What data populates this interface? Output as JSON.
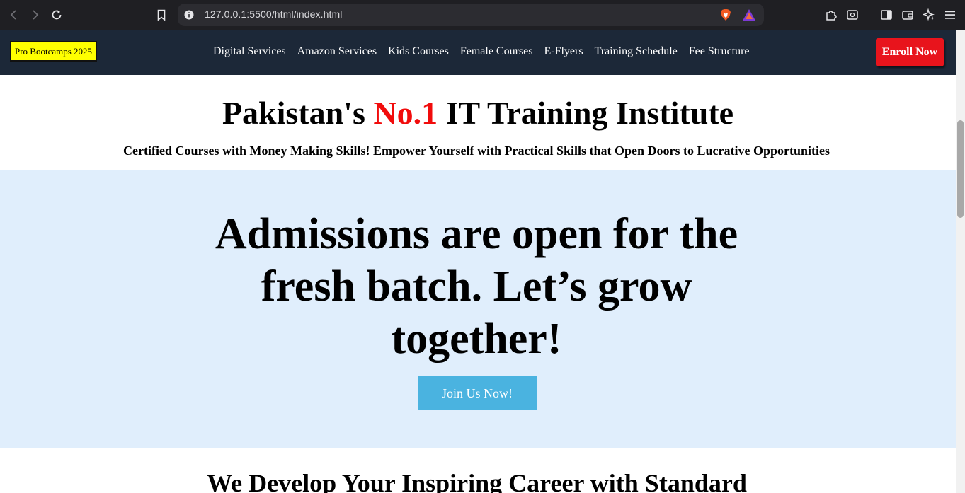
{
  "browser": {
    "url": "127.0.0.1:5500/html/index.html",
    "icons": [
      "back-icon",
      "forward-icon",
      "reload-icon",
      "bookmark-icon",
      "info-icon",
      "brave-shield-icon",
      "brave-rewards-icon",
      "extensions-icon",
      "screenshot-icon",
      "sidebar-icon",
      "wallet-icon",
      "leo-ai-icon",
      "menu-icon"
    ]
  },
  "navbar": {
    "brand": "Pro Bootcamps 2025",
    "links": [
      "Digital Services",
      "Amazon Services",
      "Kids Courses",
      "Female Courses",
      "E-Flyers",
      "Training Schedule",
      "Fee Structure"
    ],
    "enroll": "Enroll Now"
  },
  "hero": {
    "title_before": "Pakistan's ",
    "title_accent": "No.1",
    "title_after": " IT Training Institute",
    "subtitle": "Certified Courses with Money Making Skills! Empower Yourself with Practical Skills that Open Doors to Lucrative Opportunities"
  },
  "admissions": {
    "heading": "Admissions are open for the fresh batch. Let’s grow together!",
    "button": "Join Us Now!"
  },
  "career": {
    "heading": "We Develop Your Inspiring Career with Standard"
  },
  "colors": {
    "navbar_bg": "#1c2838",
    "brand_bg": "#ffff00",
    "enroll_bg": "#e8141c",
    "accent_red": "#f10c0c",
    "admissions_bg": "#e0eefc",
    "join_button_bg": "#4ab3e0"
  }
}
